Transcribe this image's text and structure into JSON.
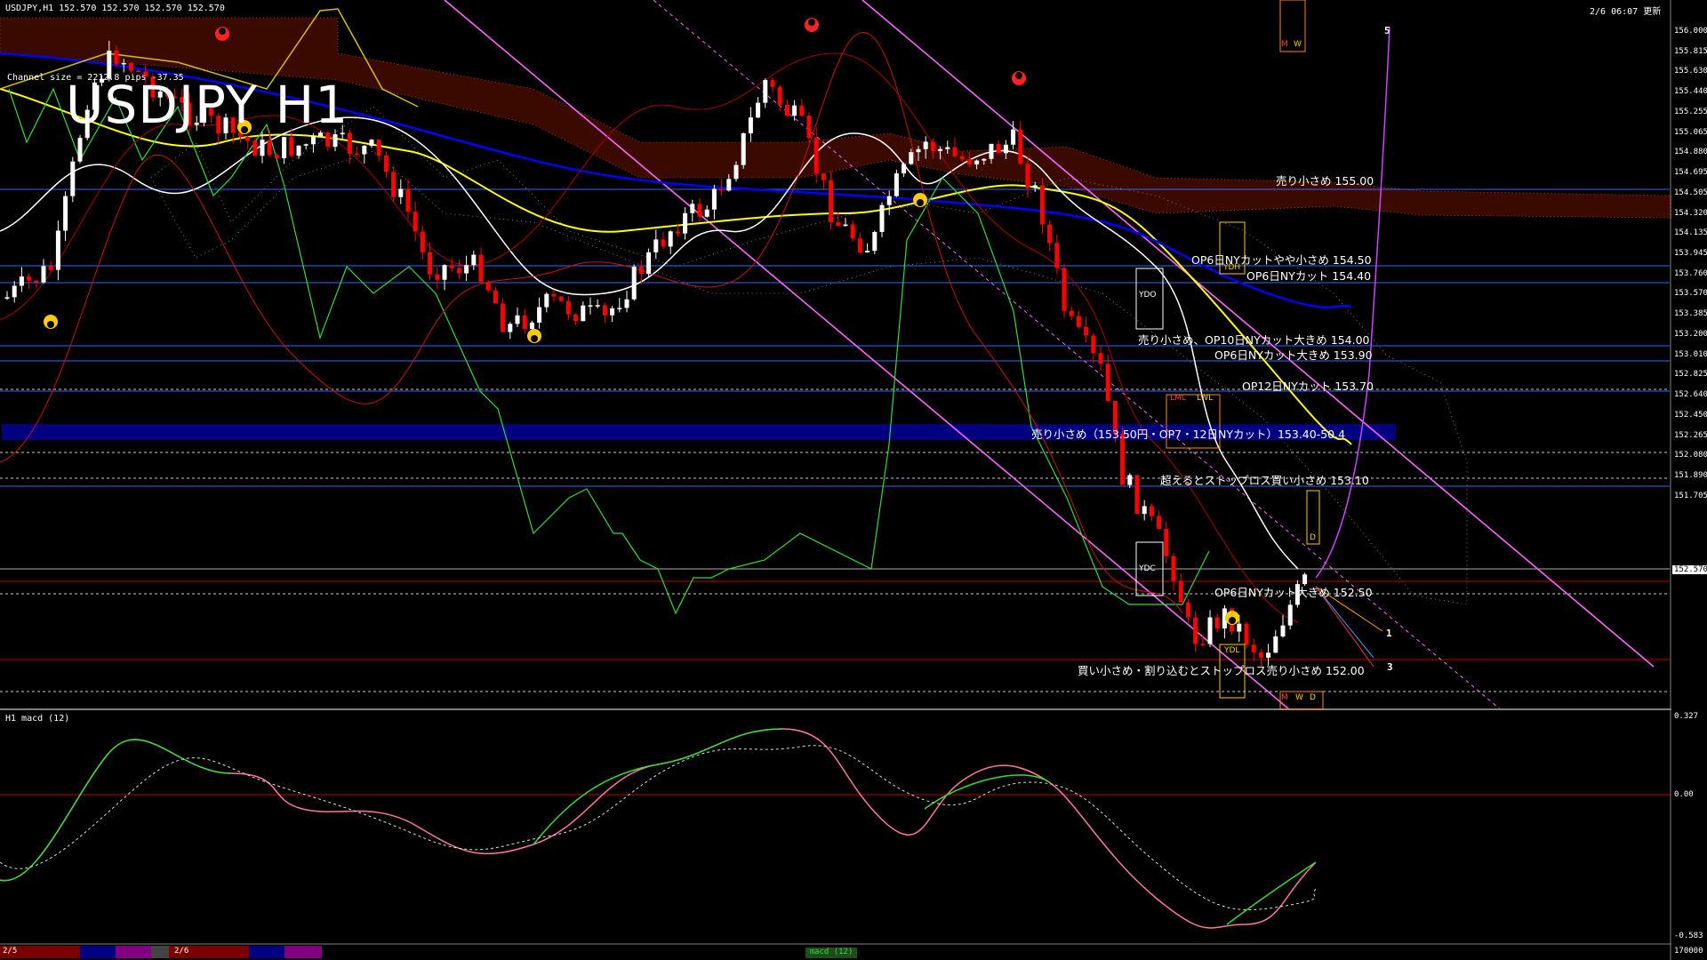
{
  "header": {
    "symbol_info": "USDJPY,H1  152.570 152.570 152.570 152.570",
    "channel_info": "Channel size = 2212.8 pips  -37.35",
    "timestamp": "2/6 06:07 更新",
    "big_title": "USDJPY H1"
  },
  "price_axis": {
    "labels": [
      "156.000",
      "155.815",
      "155.630",
      "155.440",
      "155.255",
      "155.065",
      "154.880",
      "154.695",
      "154.505",
      "154.320",
      "154.135",
      "153.945",
      "153.760",
      "153.570",
      "153.385",
      "153.200",
      "153.010",
      "152.825",
      "152.640",
      "152.450",
      "152.265",
      "152.080",
      "151.890",
      "151.705"
    ],
    "current": "152.570"
  },
  "macd_panel": {
    "title": "H1  macd (12)",
    "axis_top": "0.327",
    "axis_zero": "0.00",
    "axis_bottom": "-0.583",
    "axis_base": "170000",
    "footer_label": "macd (12)"
  },
  "annotations": [
    {
      "text": "売り小さめ 155.00"
    },
    {
      "text": "OP6日NYカットやや小さめ 154.50"
    },
    {
      "text": "OP6日NYカット 154.40"
    },
    {
      "text": "売り小さめ、OP10日NYカット大きめ 154.00"
    },
    {
      "text": "OP6日NYカット大きめ 153.90"
    },
    {
      "text": "OP12日NYカット 153.70"
    },
    {
      "text": "売り小さめ（153.50円・OP7・12日NYカット）153.40-50.4"
    },
    {
      "text": "超えるとストップロス買い小さめ 153.10"
    },
    {
      "text": "OP6日NYカット大きめ 152.50"
    },
    {
      "text": "買い小さめ・割り込むとストップロス売り小さめ 152.00"
    }
  ],
  "wave_labels": [
    "5",
    "1",
    "3"
  ],
  "level_tags": {
    "ydo": "YDO",
    "ydc": "YDC",
    "ydh": "YDH",
    "ydl": "YDL",
    "lml": "LML",
    "lwl": "LWL",
    "m": "M",
    "w": "W",
    "d": "D"
  },
  "time_axis": {
    "labels": [
      "2/5",
      "2/6"
    ]
  },
  "colors": {
    "background": "#000000",
    "bull_candle": "#ffffff",
    "bear_candle": "#ff0000",
    "band": "#000080",
    "ema_yellow": "#ffff00",
    "ema_blue": "#0000ff",
    "macd_up": "#00ff00",
    "macd_down": "#ff7799",
    "channel": "#ff66ff"
  }
}
